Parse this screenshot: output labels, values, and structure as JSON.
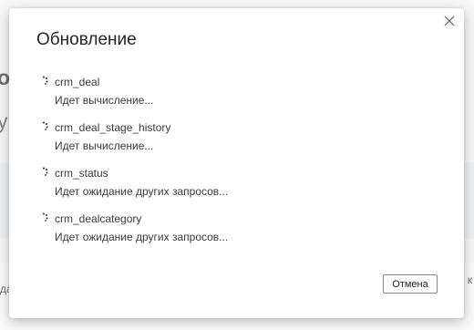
{
  "background": {
    "heading_fragment": "о",
    "subheading_fragment": "у",
    "left_text_fragment": "да",
    "right_text_fragment": "к"
  },
  "dialog": {
    "title": "Обновление",
    "close_icon": "close-icon",
    "queries": [
      {
        "name": "crm_deal",
        "status": "Идет вычисление..."
      },
      {
        "name": "crm_deal_stage_history",
        "status": "Идет вычисление..."
      },
      {
        "name": "crm_status",
        "status": "Идет ожидание других запросов..."
      },
      {
        "name": "crm_dealcategory",
        "status": "Идет ожидание других запросов..."
      }
    ],
    "cancel_label": "Отмена"
  },
  "colors": {
    "text": "#3b3a39",
    "title": "#252423",
    "button_border": "#8a8886"
  }
}
